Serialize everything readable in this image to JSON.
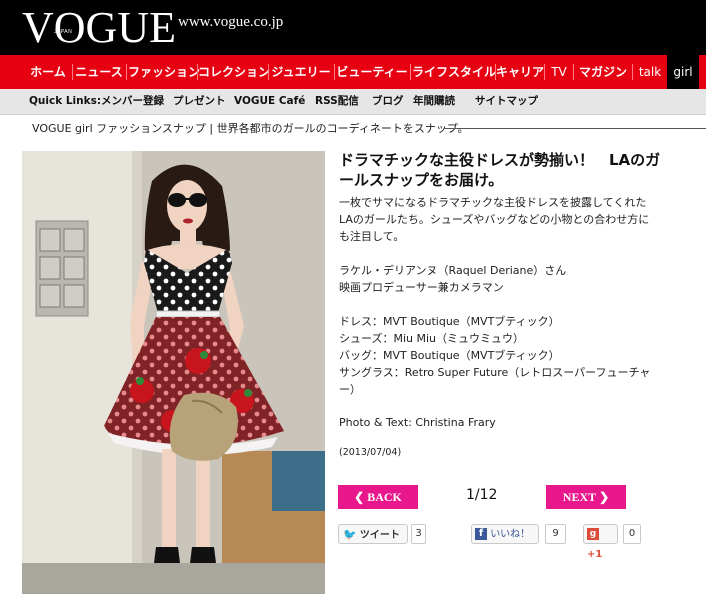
{
  "header": {
    "logo_text": "VOGUE",
    "logo_sub": "JAPAN",
    "site_url": "www.vogue.co.jp"
  },
  "nav": {
    "items": [
      "ホーム",
      "ニュース",
      "ファッション",
      "コレクション",
      "ジュエリー",
      "ビューティー",
      "ライフスタイル",
      "キャリア",
      "TV",
      "マガジン",
      "talk",
      "girl"
    ],
    "active": "girl",
    "color": "#e60012"
  },
  "quick_links": {
    "label": "Quick Links:",
    "items": [
      "メンバー登録",
      "プレゼント",
      "VOGUE Café",
      "RSS配信",
      "ブログ",
      "年間購読",
      "サイトマップ"
    ]
  },
  "breadcrumb": "VOGUE girl ファッションスナップ | 世界各都市のガールのコーディネートをスナップ。",
  "article": {
    "title_line1": "ドラマチックな主役ドレスが勢揃い！　LAのガ",
    "title_line2": "ールスナップをお届け。",
    "intro_lines": [
      "一枚でサマになるドラマチックな主役ドレスを披露してくれた",
      "LAのガールたち。シューズやバッグなどの小物との合わせ方に",
      "も注目して。"
    ],
    "person_lines": [
      "ラケル・デリアンヌ（Raquel Deriane）さん",
      "映画プロデューサー兼カメラマン"
    ],
    "item_lines": [
      "ドレス：MVT Boutique（MVTブティック）",
      "シューズ：Miu Miu（ミュウミュウ）",
      "バッグ：MVT Boutique（MVTブティック）",
      "サングラス：Retro Super Future（レトロスーパーフューチャ",
      "ー）"
    ],
    "credit": "Photo & Text: Christina Frary",
    "date": "(2013/07/04)"
  },
  "pager": {
    "back_label": "BACK",
    "next_label": "NEXT",
    "count": "1/12",
    "accent": "#e8188c"
  },
  "social": {
    "tweet_label": "ツイート",
    "tweet_count": "3",
    "like_label": "いいね！",
    "like_count": "9",
    "plus_label": "+1",
    "plus_count": "0"
  }
}
